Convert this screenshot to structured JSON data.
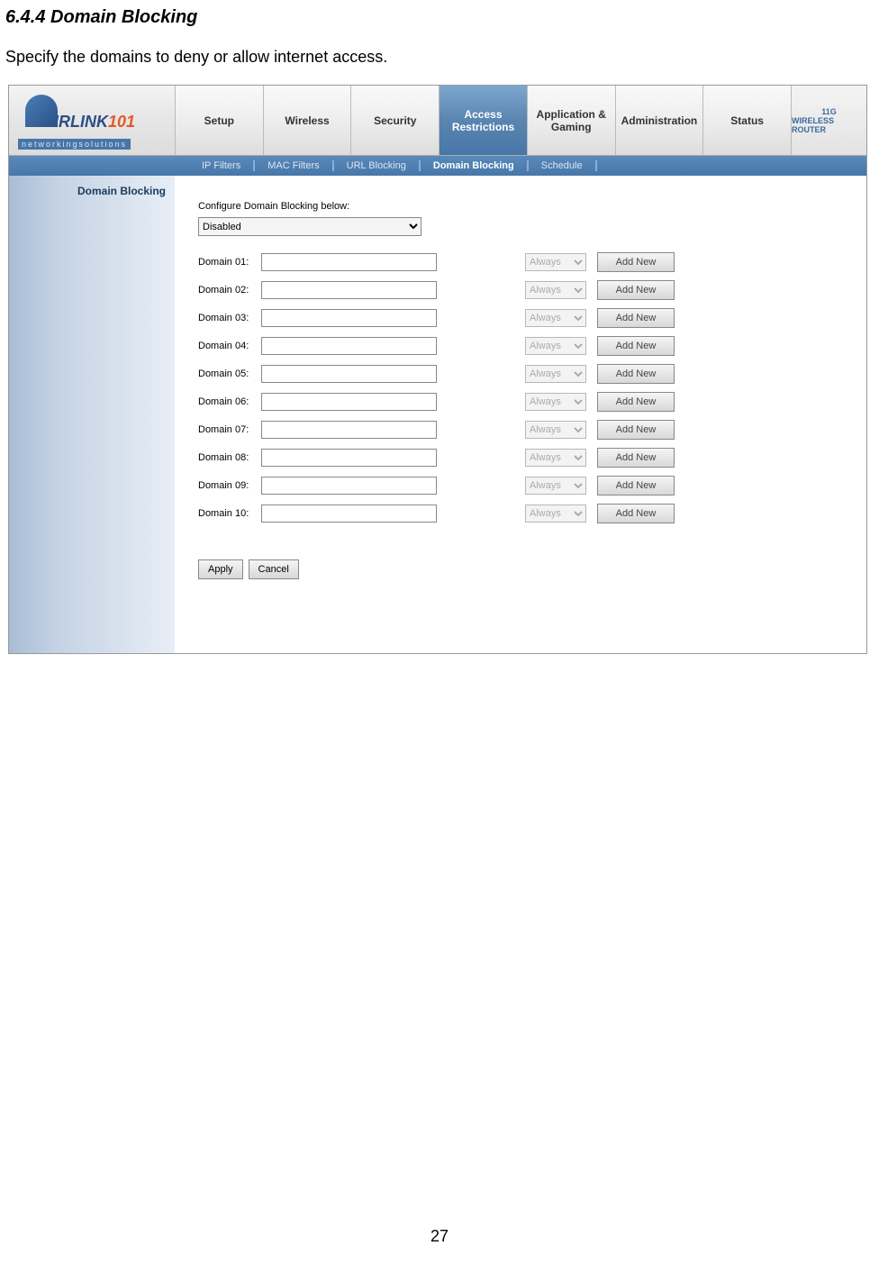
{
  "doc": {
    "heading": "6.4.4 Domain Blocking",
    "subtext": "Specify the domains to deny or allow internet access.",
    "page_number": "27"
  },
  "header": {
    "logo_text": "IRLINK",
    "logo_suffix": "101",
    "tagline": "networkingsolutions",
    "badge_line1": "11G",
    "badge_line2": "WIRELESS ROUTER"
  },
  "main_tabs": [
    "Setup",
    "Wireless",
    "Security",
    "Access Restrictions",
    "Application & Gaming",
    "Administration",
    "Status"
  ],
  "active_main_tab": 3,
  "sub_tabs": [
    "IP Filters",
    "MAC Filters",
    "URL Blocking",
    "Domain Blocking",
    "Schedule"
  ],
  "active_sub_tab": 3,
  "sidebar": {
    "title": "Domain Blocking"
  },
  "form": {
    "config_label": "Configure Domain Blocking below:",
    "mode_value": "Disabled",
    "domain_rows": [
      {
        "label": "Domain 01:",
        "value": "",
        "schedule": "Always",
        "button": "Add New"
      },
      {
        "label": "Domain 02:",
        "value": "",
        "schedule": "Always",
        "button": "Add New"
      },
      {
        "label": "Domain 03:",
        "value": "",
        "schedule": "Always",
        "button": "Add New"
      },
      {
        "label": "Domain 04:",
        "value": "",
        "schedule": "Always",
        "button": "Add New"
      },
      {
        "label": "Domain 05:",
        "value": "",
        "schedule": "Always",
        "button": "Add New"
      },
      {
        "label": "Domain 06:",
        "value": "",
        "schedule": "Always",
        "button": "Add New"
      },
      {
        "label": "Domain 07:",
        "value": "",
        "schedule": "Always",
        "button": "Add New"
      },
      {
        "label": "Domain 08:",
        "value": "",
        "schedule": "Always",
        "button": "Add New"
      },
      {
        "label": "Domain 09:",
        "value": "",
        "schedule": "Always",
        "button": "Add New"
      },
      {
        "label": "Domain 10:",
        "value": "",
        "schedule": "Always",
        "button": "Add New"
      }
    ],
    "apply_label": "Apply",
    "cancel_label": "Cancel"
  }
}
